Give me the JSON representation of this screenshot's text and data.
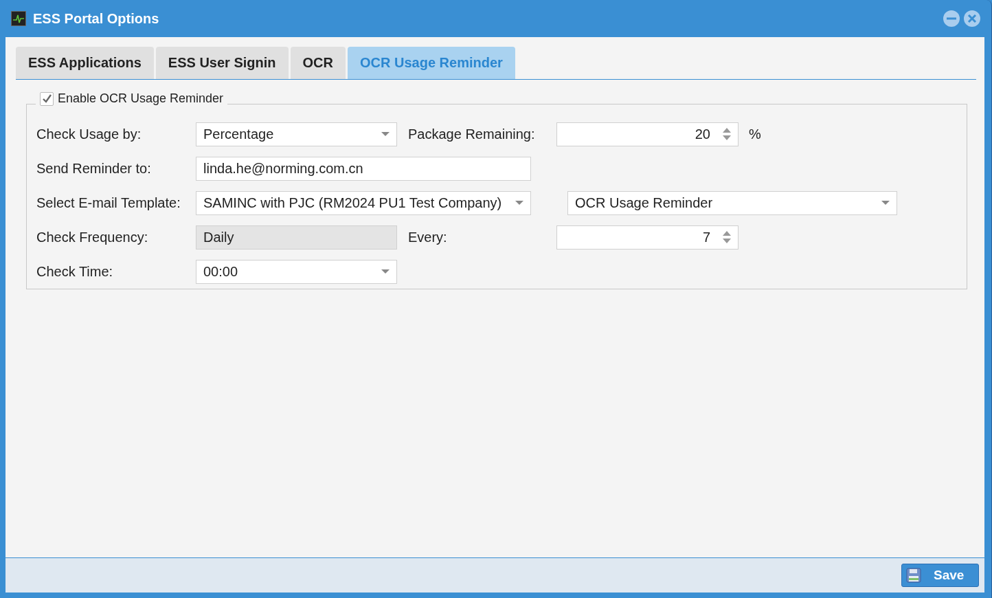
{
  "window": {
    "title": "ESS Portal Options"
  },
  "tabs": [
    {
      "label": "ESS Applications",
      "selected": false
    },
    {
      "label": "ESS User Signin",
      "selected": false
    },
    {
      "label": "OCR",
      "selected": false
    },
    {
      "label": "OCR Usage Reminder",
      "selected": true
    }
  ],
  "group": {
    "label": "Enable OCR Usage Reminder",
    "checked": true
  },
  "rows": [
    {
      "label": "Check Usage by:",
      "field": {
        "kind": "select",
        "value": "Percentage"
      },
      "label2": "Package Remaining:",
      "field2": {
        "kind": "spinner",
        "value": "20"
      },
      "unit": "%"
    },
    {
      "label": "Send Reminder to:",
      "field": {
        "kind": "text",
        "value": "linda.he@norming.com.cn"
      }
    },
    {
      "label": "Select E-mail Template:",
      "field": {
        "kind": "select",
        "value": "SAMINC with PJC (RM2024 PU1 Test Company)"
      },
      "field2": {
        "kind": "select",
        "value": "OCR Usage Reminder"
      }
    },
    {
      "label": "Check Frequency:",
      "field": {
        "kind": "readonly",
        "value": "Daily"
      },
      "label2": "Every:",
      "field2": {
        "kind": "spinner",
        "value": "7"
      }
    },
    {
      "label": "Check Time:",
      "field": {
        "kind": "select",
        "value": "00:00"
      }
    }
  ],
  "footer": {
    "save": "Save"
  }
}
